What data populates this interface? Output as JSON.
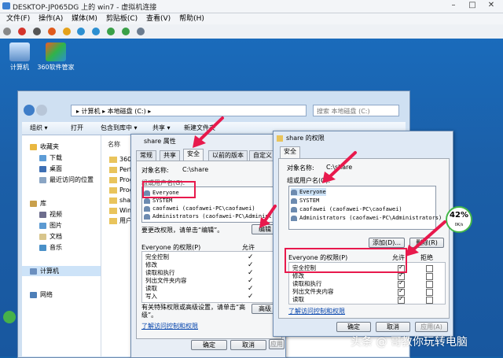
{
  "host": {
    "title": "DESKTOP-JP065DG 上的 win7 - 虚拟机连接",
    "menu": [
      "文件(F)",
      "操作(A)",
      "媒体(M)",
      "剪贴板(C)",
      "查看(V)",
      "帮助(H)"
    ]
  },
  "desktop": {
    "icons": [
      "计算机",
      "360软件管家"
    ]
  },
  "explorer": {
    "breadcrumb": "▸ 计算机 ▸ 本地磁盘 (C:) ▸",
    "search_placeholder": "搜索 本地磁盘 (C:)",
    "commands": [
      "组织 ▾",
      "打开",
      "包含到库中 ▾",
      "共享 ▾",
      "新建文件夹"
    ],
    "nav": [
      "收藏夹",
      "下载",
      "桌面",
      "最近访问的位置",
      "库",
      "视频",
      "图片",
      "文档",
      "音乐",
      "计算机",
      "网络"
    ],
    "files_header": "名称",
    "files": [
      "360",
      "Perf",
      "Prog",
      "Prog",
      "share",
      "Win",
      "用户"
    ]
  },
  "props": {
    "title": "share 属性",
    "tabs": [
      "常规",
      "共享",
      "安全",
      "以前的版本",
      "自定义"
    ],
    "object_label": "对象名称:",
    "object_value": "C:\\share",
    "group_label": "组或用户名(G):",
    "users": [
      "Everyone",
      "SYSTEM",
      "caofawei (caofawei-PC\\caofawei)",
      "Administrators (caofawei-PC\\Administrators)"
    ],
    "change_text": "要更改权限，请单击“编辑”。",
    "edit_button": "编辑",
    "perm_header": "Everyone 的权限(P)",
    "allow_header": "允许",
    "permissions": [
      "完全控制",
      "修改",
      "读取和执行",
      "列出文件夹内容",
      "读取",
      "写入"
    ],
    "special_text": "有关特殊权限或高级设置，请单击“高级”。",
    "advanced_button": "高级",
    "link": "了解访问控制和权限",
    "ok": "确定",
    "cancel": "取消",
    "apply": "应用(A)"
  },
  "perm_dialog": {
    "title": "share 的权限",
    "tab": "安全",
    "object_label": "对象名称:",
    "object_value": "C:\\share",
    "group_label": "组或用户名(G):",
    "users": [
      "Everyone",
      "SYSTEM",
      "caofawei (caofawei-PC\\caofawei)",
      "Administrators (caofawei-PC\\Administrators)"
    ],
    "add_button": "添加(D)...",
    "remove_button": "删除(R)",
    "perm_header": "Everyone 的权限(P)",
    "allow_header": "允许",
    "deny_header": "拒绝",
    "permissions": [
      "完全控制",
      "修改",
      "读取和执行",
      "列出文件夹内容",
      "读取"
    ],
    "link": "了解访问控制和权限",
    "ok": "确定",
    "cancel": "取消",
    "apply": "应用(A)"
  },
  "speed_widget": {
    "percent": "42%",
    "rate": "0K/s"
  },
  "watermark": "头条 @ 哥教你玩转电脑",
  "colors": {
    "annotation": "#e8194c",
    "accent": "#1560a8"
  }
}
